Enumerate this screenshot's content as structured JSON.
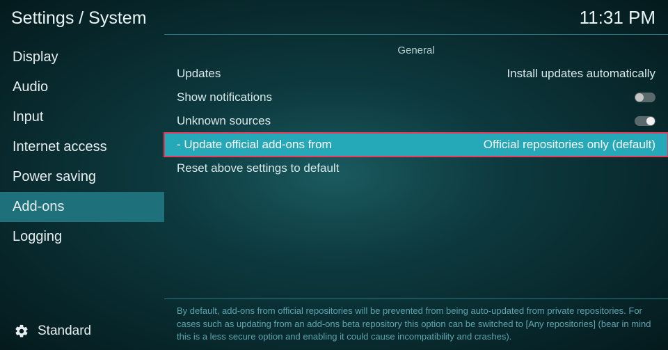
{
  "breadcrumb": "Settings / System",
  "clock": "11:31 PM",
  "sidebar": {
    "items": [
      {
        "label": "Display",
        "active": false
      },
      {
        "label": "Audio",
        "active": false
      },
      {
        "label": "Input",
        "active": false
      },
      {
        "label": "Internet access",
        "active": false
      },
      {
        "label": "Power saving",
        "active": false
      },
      {
        "label": "Add-ons",
        "active": true
      },
      {
        "label": "Logging",
        "active": false
      }
    ],
    "level_label": "Standard"
  },
  "content": {
    "section": "General",
    "rows": [
      {
        "label": "Updates",
        "value": "Install updates automatically",
        "type": "select",
        "indent": false,
        "selected": false
      },
      {
        "label": "Show notifications",
        "type": "toggle",
        "on": false,
        "indent": false,
        "selected": false
      },
      {
        "label": "Unknown sources",
        "type": "toggle",
        "on": true,
        "indent": false,
        "selected": false
      },
      {
        "label": "Update official add-ons from",
        "value": "Official repositories only (default)",
        "type": "select",
        "indent": true,
        "selected": true
      },
      {
        "label": "Reset above settings to default",
        "type": "action",
        "indent": false,
        "selected": false
      }
    ]
  },
  "help": "By default, add-ons from official repositories will be prevented from being auto-updated from private repositories. For cases such as updating from an add-ons beta repository this option can be switched to [Any repositories] (bear in mind this is a less secure option and enabling it could cause incompatibility and crashes)."
}
